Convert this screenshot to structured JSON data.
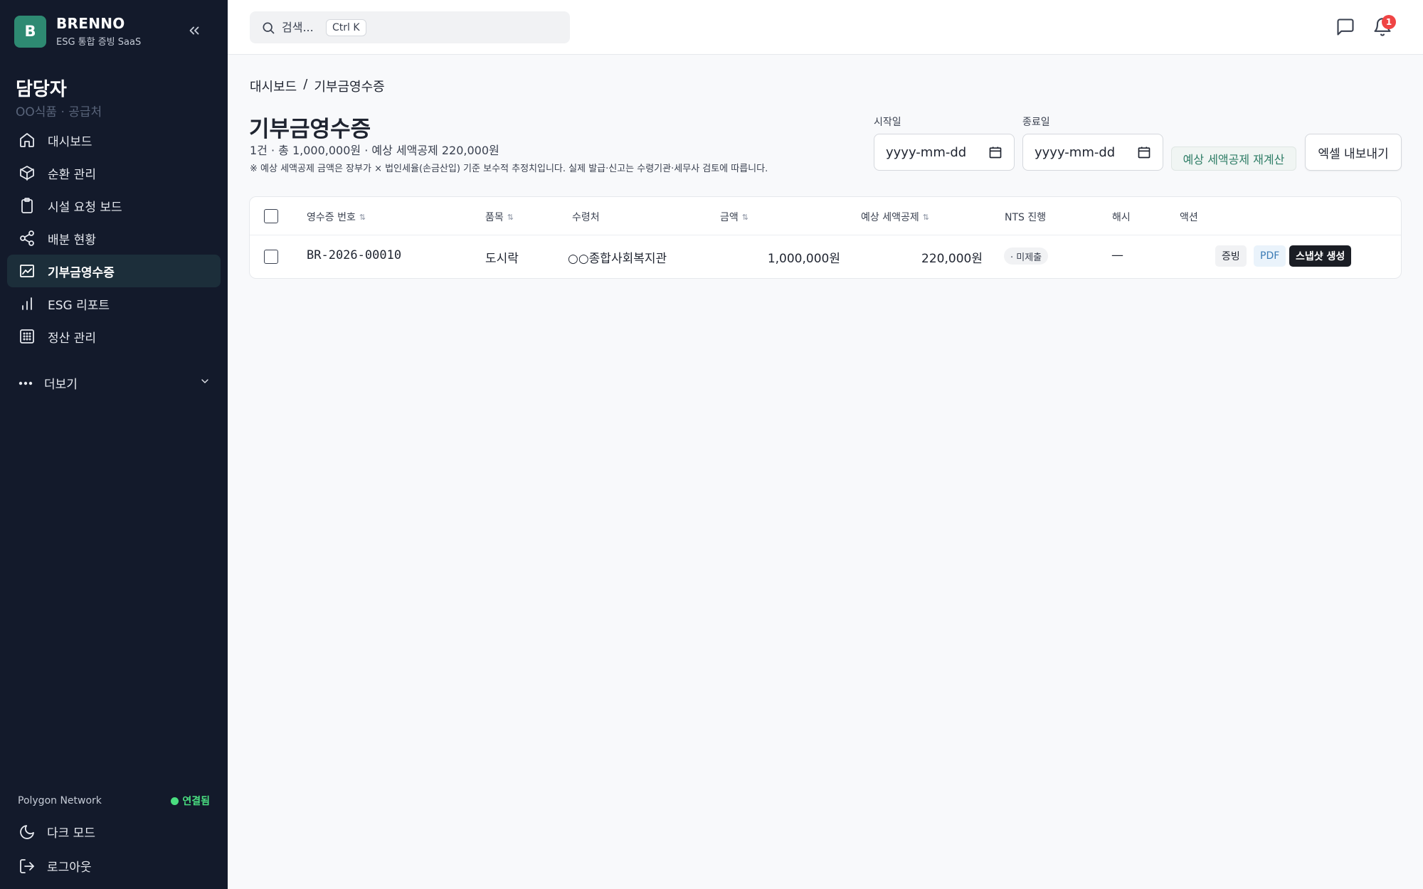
{
  "brand": {
    "logo_letter": "B",
    "name": "BRENNO",
    "subtitle": "ESG 통합 증빙 SaaS"
  },
  "user": {
    "role": "담당자",
    "org": "OO식품 · 공급처"
  },
  "nav": {
    "items": [
      {
        "label": "대시보드",
        "icon": "home-icon",
        "active": false
      },
      {
        "label": "순환 관리",
        "icon": "cube-icon",
        "active": false
      },
      {
        "label": "시설 요청 보드",
        "icon": "clipboard-icon",
        "active": false
      },
      {
        "label": "배분 현황",
        "icon": "share-icon",
        "active": false
      },
      {
        "label": "기부금영수증",
        "icon": "receipt-icon",
        "active": true
      },
      {
        "label": "ESG 리포트",
        "icon": "bar-chart-icon",
        "active": false
      },
      {
        "label": "정산 관리",
        "icon": "calculator-icon",
        "active": false
      }
    ],
    "more_label": "더보기"
  },
  "network": {
    "name": "Polygon Network",
    "status": "연결됨",
    "status_color": "#4ade80"
  },
  "footer_nav": {
    "dark_mode": "다크 모드",
    "logout": "로그아웃"
  },
  "search": {
    "placeholder": "검색...",
    "shortcut": "Ctrl K"
  },
  "notifications": {
    "count": "1"
  },
  "breadcrumb": {
    "home": "대시보드",
    "separator": "/",
    "current": "기부금영수증"
  },
  "page": {
    "title": "기부금영수증",
    "summary": "1건 · 총 1,000,000원 · 예상 세액공제 220,000원",
    "disclaimer": "※ 예상 세액공제 금액은 장부가 × 법인세율(손금산입) 기준 보수적 추정치입니다. 실제 발급·신고는 수령기관·세무사 검토에 따릅니다."
  },
  "filters": {
    "start_label": "시작일",
    "start_value": "yyyy-mm-dd",
    "end_label": "종료일",
    "end_value": "yyyy-mm-dd",
    "recalc_button": "예상 세액공제 재계산",
    "export_button": "엑셀 내보내기"
  },
  "table": {
    "columns": [
      "영수증 번호",
      "품목",
      "수령처",
      "금액",
      "예상 세액공제",
      "NTS 진행",
      "해시",
      "액션"
    ],
    "sort_glyph": "⇅",
    "rows": [
      {
        "receipt_no": "BR-2026-00010",
        "item": "도시락",
        "recipient": "○○종합사회복지관",
        "amount": "1,000,000원",
        "tax_credit": "220,000원",
        "nts_status": "· 미제출",
        "hash": "—",
        "actions": {
          "proof": "증빙",
          "pdf": "PDF",
          "snapshot": "스냅샷 생성"
        }
      }
    ]
  },
  "colors": {
    "sidebar_bg": "#131a2b",
    "accent": "#2e8a72",
    "badge": "#ef4444"
  }
}
